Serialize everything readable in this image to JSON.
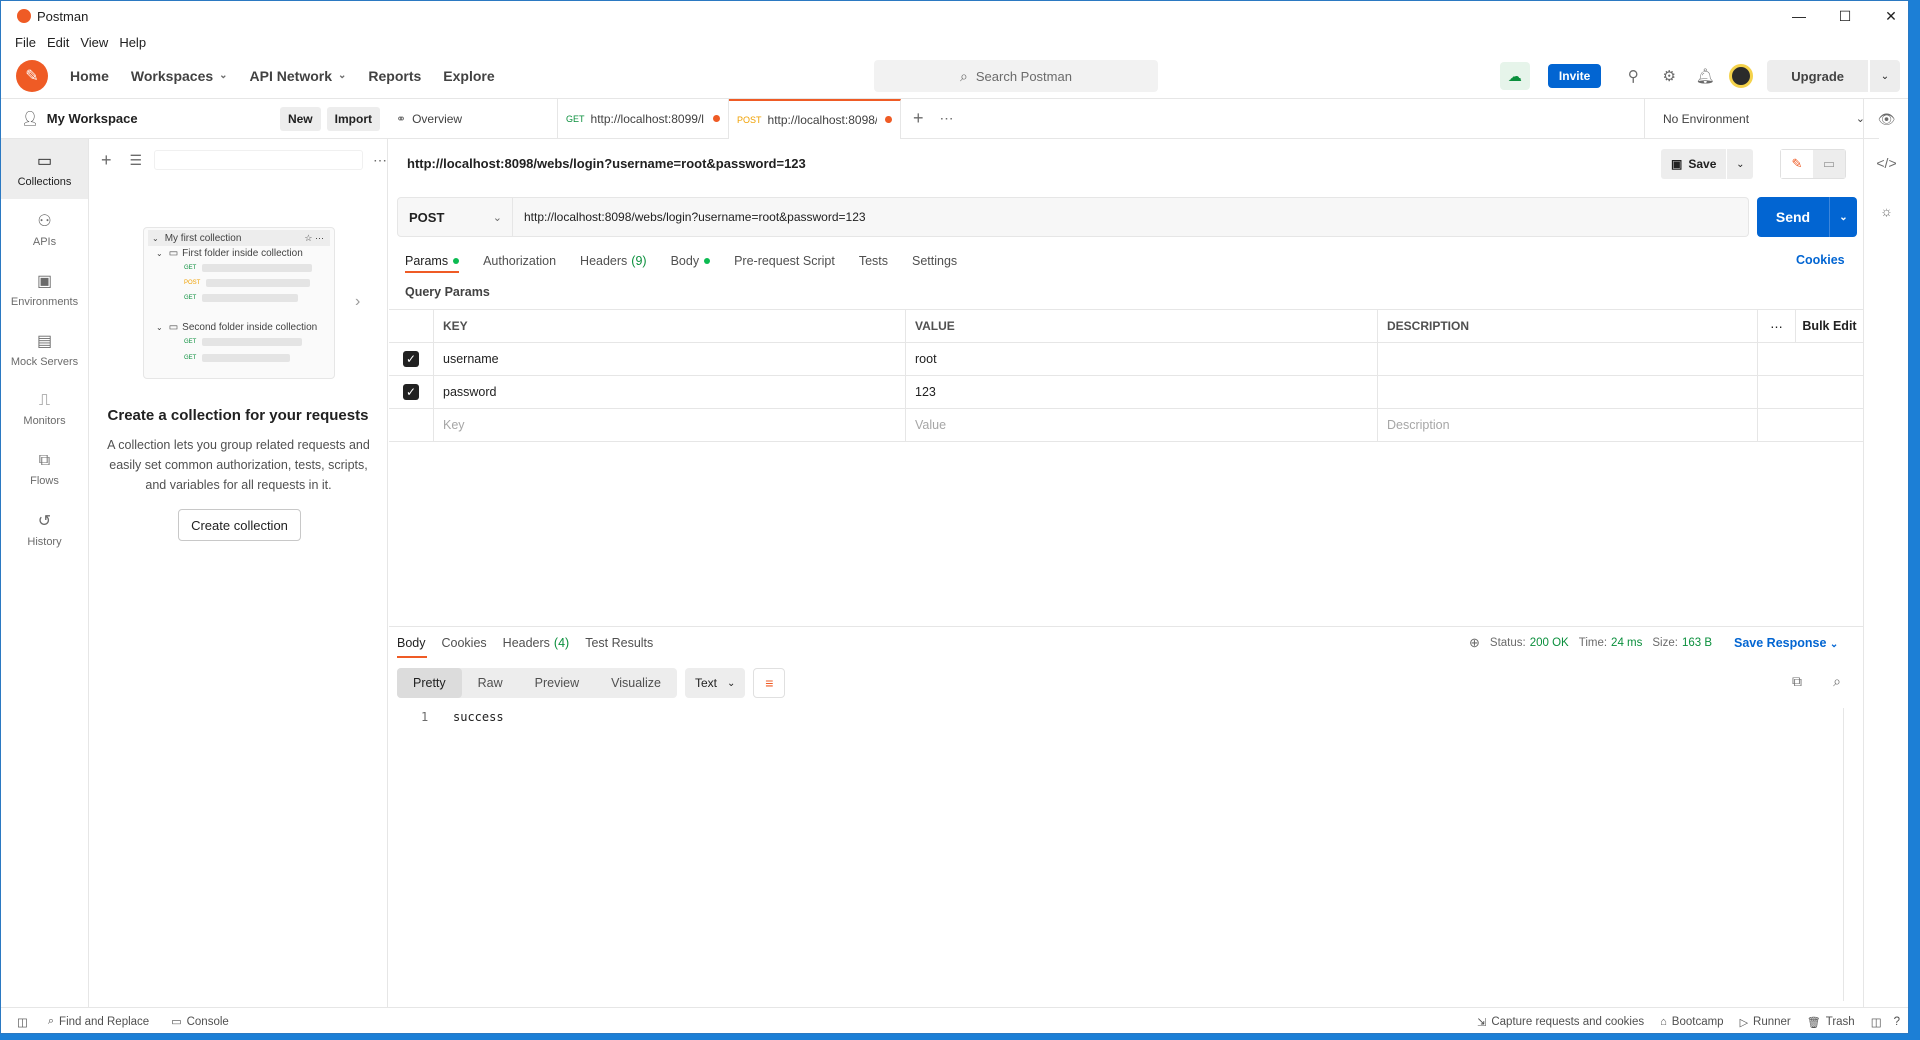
{
  "window": {
    "title": "Postman",
    "minimize": "—",
    "maximize": "☐",
    "close": "✕"
  },
  "menu": [
    "File",
    "Edit",
    "View",
    "Help"
  ],
  "header": {
    "nav": [
      "Home",
      "Workspaces",
      "API Network",
      "Reports",
      "Explore"
    ],
    "search_placeholder": "Search Postman",
    "invite": "Invite",
    "upgrade": "Upgrade"
  },
  "workspace": {
    "title": "My Workspace",
    "new_btn": "New",
    "import_btn": "Import"
  },
  "sidebar": {
    "items": [
      {
        "label": "Collections",
        "icon": "collections-icon"
      },
      {
        "label": "APIs",
        "icon": "apis-icon"
      },
      {
        "label": "Environments",
        "icon": "environments-icon"
      },
      {
        "label": "Mock Servers",
        "icon": "mock-servers-icon"
      },
      {
        "label": "Monitors",
        "icon": "monitors-icon"
      },
      {
        "label": "Flows",
        "icon": "flows-icon"
      },
      {
        "label": "History",
        "icon": "history-icon"
      }
    ]
  },
  "collections_empty": {
    "illus": {
      "collection": "My first collection",
      "folder1": "First folder inside collection",
      "folder2": "Second folder inside collection",
      "m_get": "GET",
      "m_post": "POST"
    },
    "title": "Create a collection for your requests",
    "desc": "A collection lets you group related requests and easily set common authorization, tests, scripts, and variables for all requests in it.",
    "button": "Create collection"
  },
  "tabs": [
    {
      "label": "Overview"
    },
    {
      "method": "GET",
      "label": "http://localhost:8099/l"
    },
    {
      "method": "POST",
      "label": "http://localhost:8098/"
    }
  ],
  "environment": "No Environment",
  "request": {
    "title": "http://localhost:8098/webs/login?username=root&password=123",
    "save": "Save",
    "method": "POST",
    "url": "http://localhost:8098/webs/login?username=root&password=123",
    "send": "Send",
    "tabs": {
      "params": "Params",
      "authorization": "Authorization",
      "headers": "Headers",
      "headers_count": "(9)",
      "body": "Body",
      "prerequest": "Pre-request Script",
      "tests": "Tests",
      "settings": "Settings"
    },
    "cookies": "Cookies",
    "query_params_title": "Query Params",
    "columns": {
      "key": "KEY",
      "value": "VALUE",
      "description": "DESCRIPTION",
      "bulk_edit": "Bulk Edit"
    },
    "params": [
      {
        "key": "username",
        "value": "root",
        "description": ""
      },
      {
        "key": "password",
        "value": "123",
        "description": ""
      }
    ],
    "placeholders": {
      "key": "Key",
      "value": "Value",
      "description": "Description"
    }
  },
  "response": {
    "tabs": {
      "body": "Body",
      "cookies": "Cookies",
      "headers": "Headers",
      "headers_count": "(4)",
      "test_results": "Test Results"
    },
    "status_label": "Status:",
    "status": "200 OK",
    "time_label": "Time:",
    "time": "24 ms",
    "size_label": "Size:",
    "size": "163 B",
    "save_response": "Save Response",
    "view_modes": [
      "Pretty",
      "Raw",
      "Preview",
      "Visualize"
    ],
    "format": "Text",
    "line_number": "1",
    "body": "success"
  },
  "footer": {
    "find_replace": "Find and Replace",
    "console": "Console",
    "capture": "Capture requests and cookies",
    "bootcamp": "Bootcamp",
    "runner": "Runner",
    "trash": "Trash"
  },
  "colors": {
    "accent": "#ef5b25",
    "primary": "#0265d2",
    "success": "#0a8f3c"
  }
}
